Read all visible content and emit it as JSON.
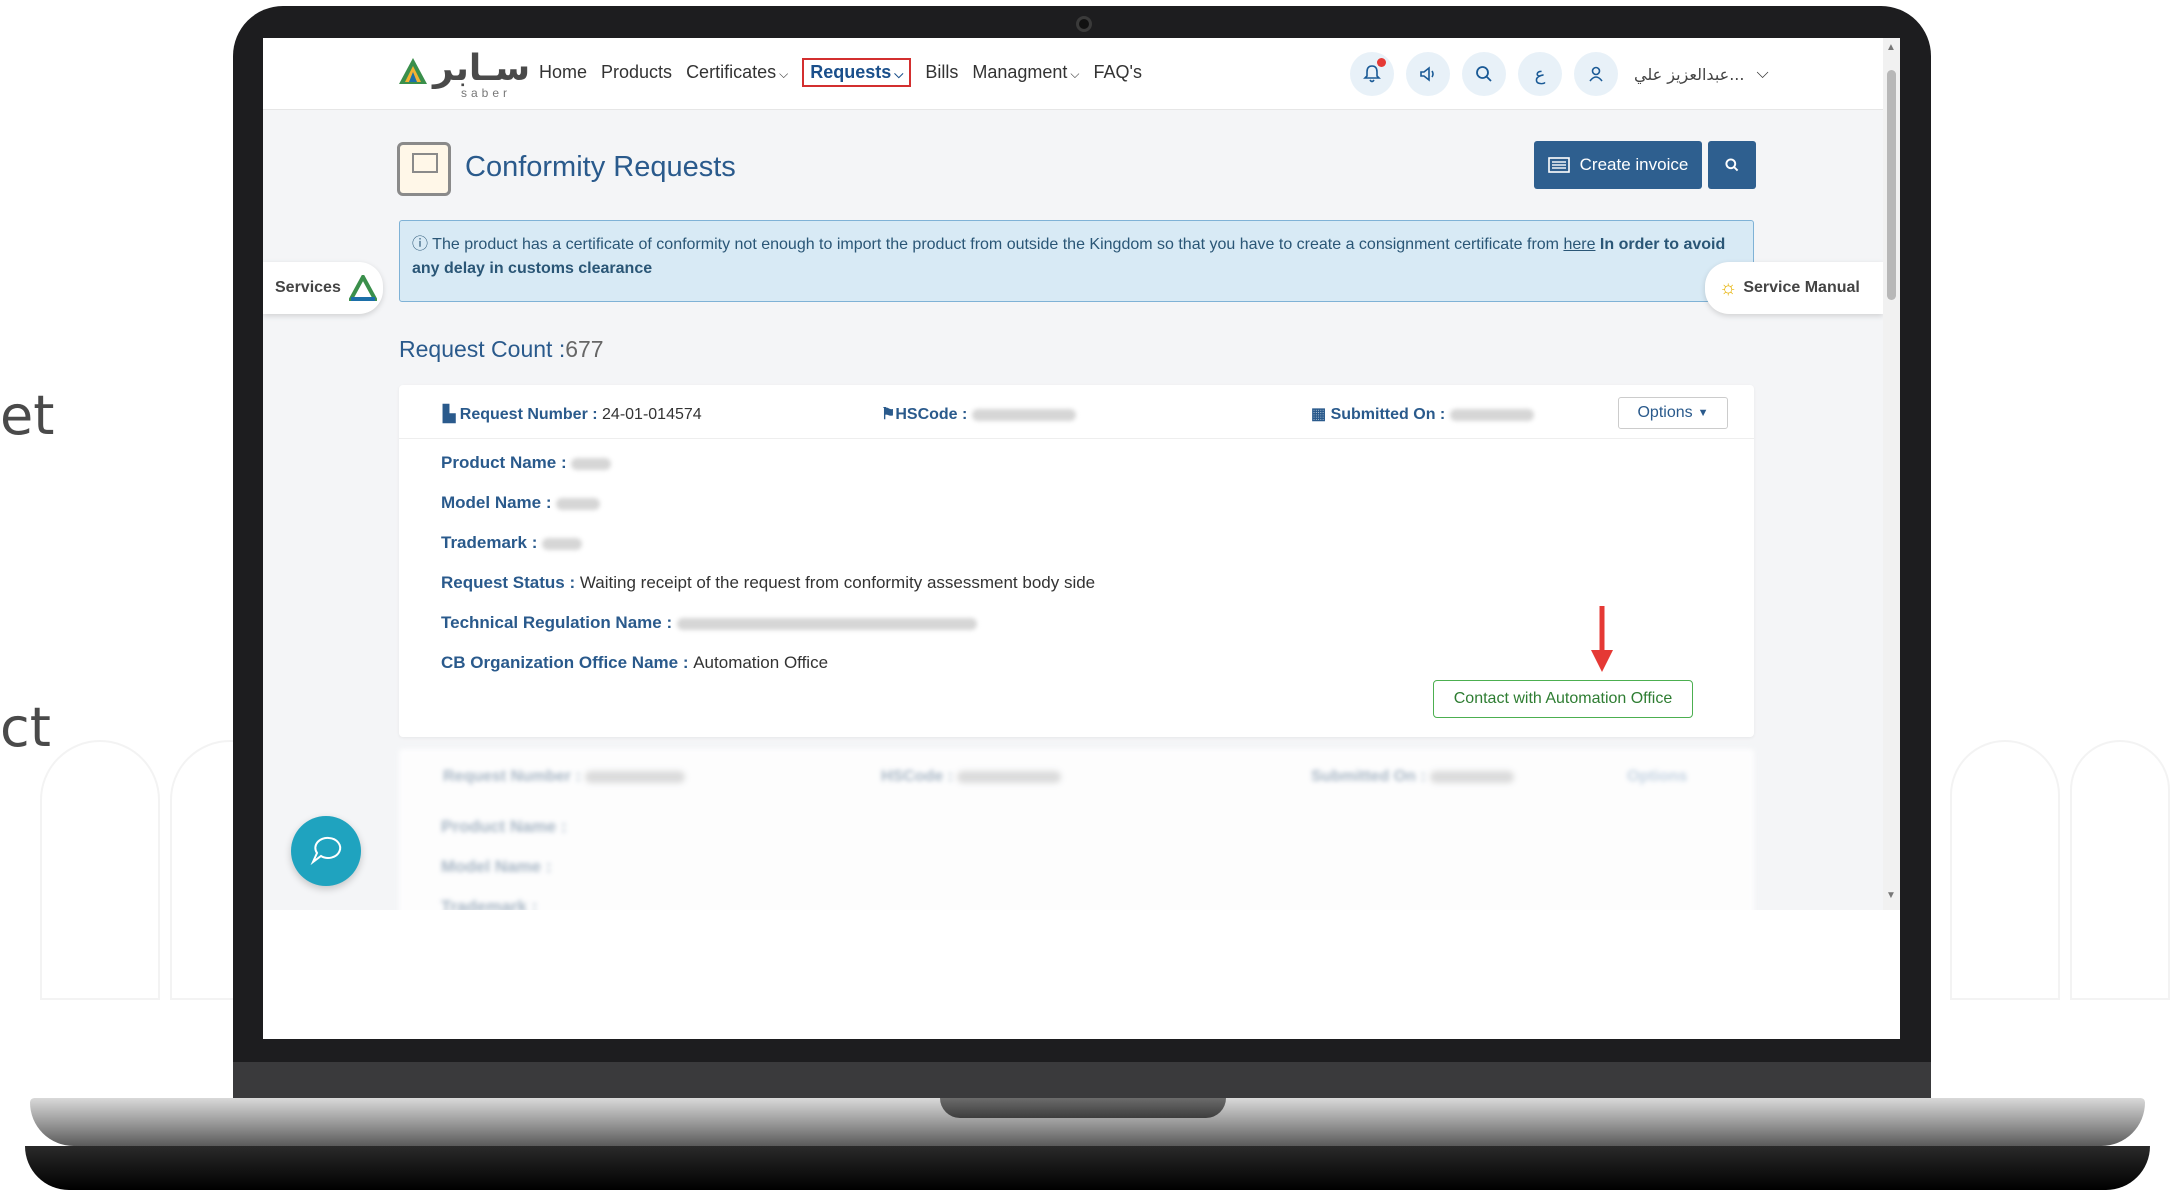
{
  "background_text": [
    "et",
    "ct"
  ],
  "navbar": {
    "logo_text": "سـابر",
    "logo_sub": "saber",
    "items": [
      {
        "label": "Home"
      },
      {
        "label": "Products"
      },
      {
        "label": "Certificates",
        "dropdown": true
      },
      {
        "label": "Requests",
        "dropdown": true,
        "active": true
      },
      {
        "label": "Bills"
      },
      {
        "label": "Managment",
        "dropdown": true
      },
      {
        "label": "FAQ's"
      }
    ],
    "icons": [
      "bell-icon",
      "speaker-icon",
      "search-icon",
      "language-icon",
      "user-icon"
    ],
    "language_glyph": "ع",
    "user_name": "عبدالعزيز علي..."
  },
  "page": {
    "title": "Conformity Requests",
    "create_invoice_label": "Create invoice"
  },
  "alert": {
    "text_before_link": " The product has a certificate of conformity not enough to import the product from outside the Kingdom so that you have to create a consignment certificate from ",
    "link_text": "here",
    "bold_text": " In order to avoid any delay in customs clearance"
  },
  "side_tabs": {
    "services": "Services",
    "service_manual": "Service Manual"
  },
  "request_count": {
    "label": "Request Count :",
    "value": "677"
  },
  "request_card": {
    "request_number_label": "Request Number :",
    "request_number": "24-01-014574",
    "hscode_label": "HSCode :",
    "submitted_on_label": "Submitted On :",
    "options_label": "Options",
    "product_name_label": "Product Name :",
    "model_name_label": "Model Name :",
    "trademark_label": "Trademark :",
    "request_status_label": "Request Status :",
    "request_status": "Waiting receipt of the request from conformity assessment body side",
    "technical_regulation_label": "Technical Regulation Name :",
    "cb_office_label": "CB Organization Office Name :",
    "cb_office": "Automation Office",
    "contact_button": "Contact with Automation Office"
  },
  "request_card_2": {
    "request_number_label": "Request Number :",
    "hscode_label": "HSCode :",
    "submitted_on_label": "Submitted On :",
    "options_label": "Options",
    "product_name_label": "Product Name :",
    "model_name_label": "Model Name :",
    "trademark_label": "Trademark :"
  },
  "colors": {
    "primary": "#2e5f8f",
    "title_blue": "#2a5a8c",
    "alert_bg": "#d8eaf5",
    "highlight_red": "#d32f2f",
    "contact_green": "#4caf50",
    "chat_teal": "#1fa3bf"
  }
}
